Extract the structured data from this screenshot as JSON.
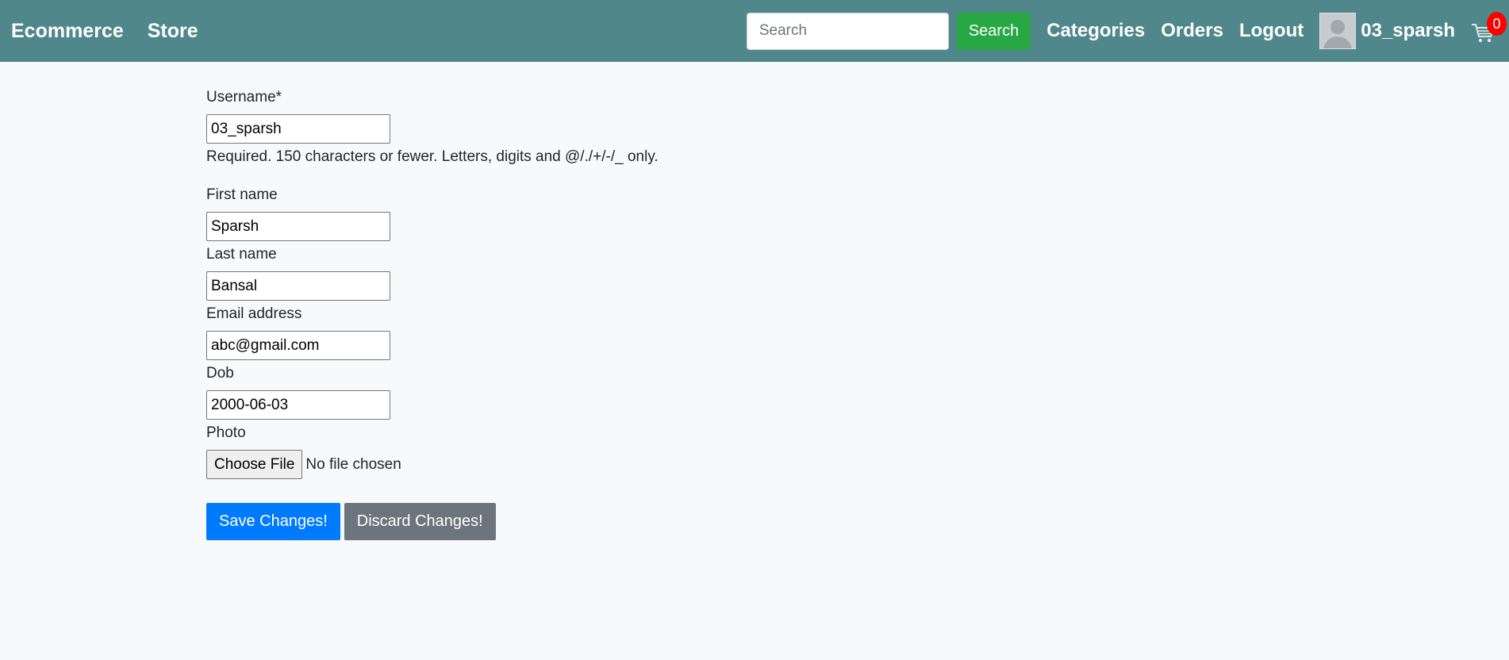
{
  "nav": {
    "brand": "Ecommerce",
    "store": "Store",
    "search_placeholder": "Search",
    "search_button": "Search",
    "categories": "Categories",
    "orders": "Orders",
    "logout": "Logout",
    "username": "03_sparsh",
    "cart_count": "0",
    "bg_color": "#4f878b"
  },
  "form": {
    "username": {
      "label": "Username*",
      "value": "03_sparsh",
      "help": "Required. 150 characters or fewer. Letters, digits and @/./+/-/_ only."
    },
    "first_name": {
      "label": "First name",
      "value": "Sparsh"
    },
    "last_name": {
      "label": "Last name",
      "value": "Bansal"
    },
    "email": {
      "label": "Email address",
      "value": "abc@gmail.com"
    },
    "dob": {
      "label": "Dob",
      "value": "2000-06-03"
    },
    "photo": {
      "label": "Photo",
      "button": "Choose File",
      "status": "No file chosen"
    },
    "save": "Save Changes!",
    "discard": "Discard Changes!"
  }
}
